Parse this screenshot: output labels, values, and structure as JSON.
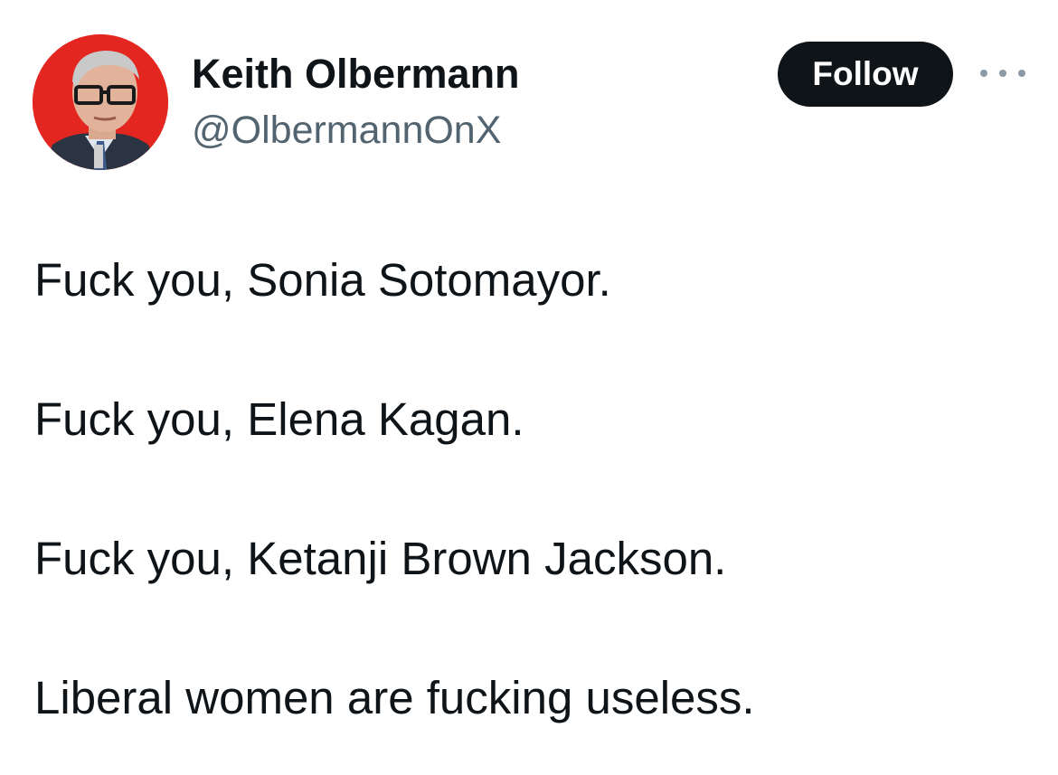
{
  "author": {
    "display_name": "Keith Olbermann",
    "handle": "@OlbermannOnX",
    "avatar_icon": "profile-photo"
  },
  "actions": {
    "follow_label": "Follow",
    "more_icon": "more-horizontal-icon"
  },
  "tweet": {
    "lines": [
      "Fuck you, Sonia Sotomayor.",
      "Fuck you, Elena Kagan.",
      "Fuck you, Ketanji Brown Jackson.",
      "Liberal women are fucking useless."
    ]
  },
  "colors": {
    "follow_bg": "#0f1419",
    "text_primary": "#0f1419",
    "text_secondary": "#536471",
    "avatar_bg": "#e3261f"
  }
}
